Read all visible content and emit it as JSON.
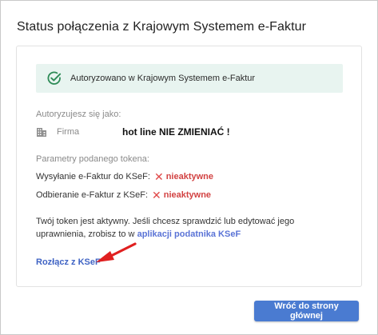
{
  "dialog": {
    "title": "Status połączenia z Krajowym Systemem e-Faktur"
  },
  "alert": {
    "icon": "check-circle-icon",
    "text": "Autoryzowano w Krajowym Systemem e-Faktur",
    "color": "#2e8b57"
  },
  "auth": {
    "label": "Autoryzujesz się jako:",
    "entity_icon": "building-icon",
    "entity_type": "Firma",
    "entity_name": "hot line NIE ZMIENIAĆ !"
  },
  "token": {
    "label": "Parametry podanego tokena:",
    "permissions": [
      {
        "label": "Wysyłanie e-Faktur do KSeF:",
        "icon": "x-icon",
        "status": "nieaktywne"
      },
      {
        "label": "Odbieranie e-Faktur z KSeF:",
        "icon": "x-icon",
        "status": "nieaktywne"
      }
    ]
  },
  "info": {
    "text": "Twój token jest aktywny. Jeśli chcesz sprawdzić lub edytować jego uprawnienia, zrobisz to w",
    "link": "aplikacji podatnika KSeF"
  },
  "actions": {
    "disconnect": "Rozłącz z KSeF",
    "back": "Wróć do strony głównej"
  },
  "colors": {
    "accent": "#4a7bd1",
    "danger": "#d24242",
    "alert_bg": "#e8f4f0"
  }
}
